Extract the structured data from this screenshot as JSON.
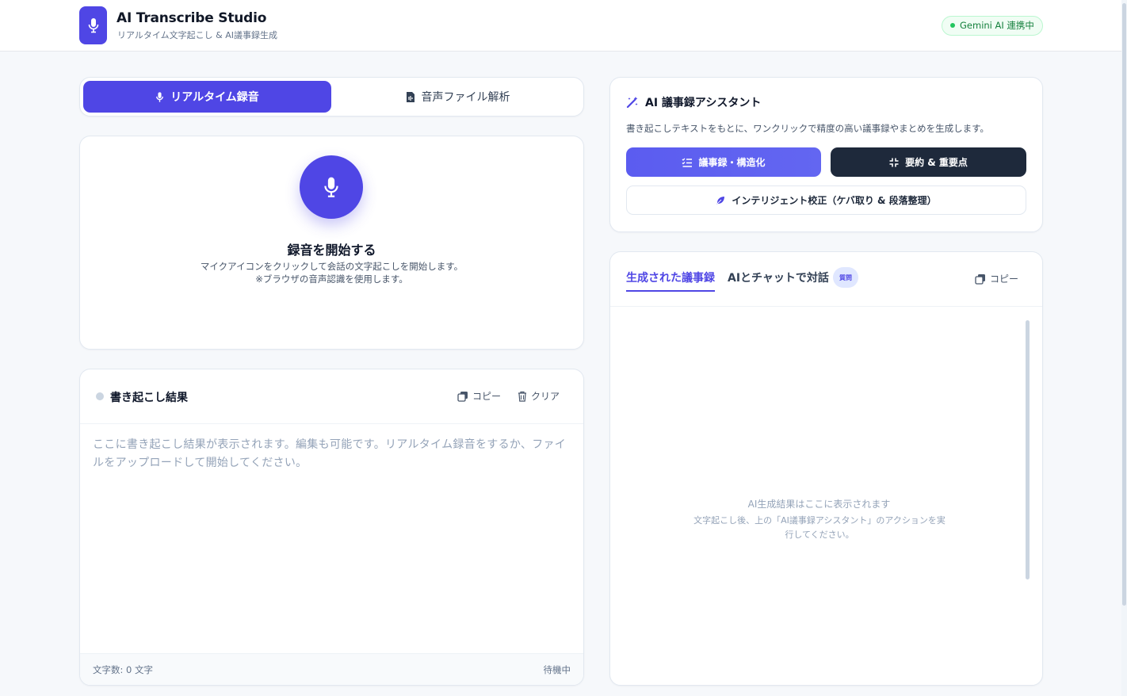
{
  "header": {
    "title": "AI Transcribe Studio",
    "subtitle": "リアルタイム文字起こし & AI議事録生成",
    "status": "Gemini AI 連携中"
  },
  "mode_tabs": [
    {
      "label": "リアルタイム録音",
      "active": true,
      "icon": "mic-icon"
    },
    {
      "label": "音声ファイル解析",
      "active": false,
      "icon": "audio-file-icon"
    }
  ],
  "recorder": {
    "title": "録音を開始する",
    "description_line1": "マイクアイコンをクリックして会話の文字起こしを開始します。",
    "description_line2": "※ブラウザの音声認識を使用します。"
  },
  "transcript": {
    "title": "書き起こし結果",
    "copy_label": "コピー",
    "clear_label": "クリア",
    "placeholder": "ここに書き起こし結果が表示されます。編集も可能です。リアルタイム録音をするか、ファイルをアップロードして開始してください。",
    "char_count": "文字数: 0 文字",
    "state": "待機中"
  },
  "assistant": {
    "title": "AI 議事録アシスタント",
    "description": "書き起こしテキストをもとに、ワンクリックで精度の高い議事録やまとめを生成します。",
    "buttons": {
      "minutes": "議事録・構造化",
      "summary": "要約 & 重要点",
      "proofread": "インテリジェント校正（ケバ取り & 段落整理）"
    }
  },
  "result": {
    "tabs": {
      "generated": "生成された議事録",
      "chat": "AIとチャットで対話",
      "chat_badge": "質問"
    },
    "copy_label": "コピー",
    "empty_title": "AI生成結果はここに表示されます",
    "empty_desc": "文字起こし後、上の「AI議事録アシスタント」のアクションを実行してください。"
  },
  "colors": {
    "primary": "#4f46e5",
    "dark": "#1e293b",
    "success": "#22c55e",
    "background": "#f6f8fb"
  }
}
